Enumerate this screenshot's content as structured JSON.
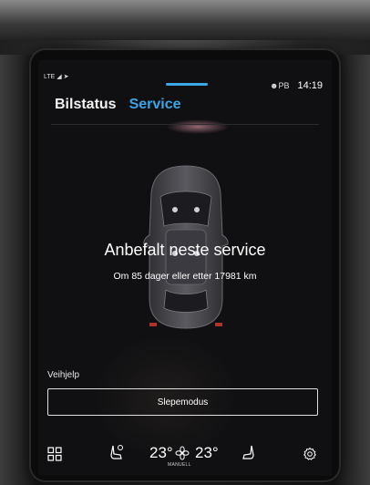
{
  "status_bar": {
    "network": "LTE",
    "system_indicator": "PB",
    "time": "14:19"
  },
  "tabs": [
    {
      "label": "Bilstatus",
      "active": false
    },
    {
      "label": "Service",
      "active": true
    }
  ],
  "service": {
    "title": "Anbefalt neste service",
    "subtitle": "Om 85 dager eller etter 17981 km"
  },
  "roadside": {
    "label": "Veihjelp",
    "tow_mode_button": "Slepemodus"
  },
  "climate": {
    "temp_left": "23°",
    "temp_right": "23°",
    "fan_mode": "MANUELL"
  },
  "colors": {
    "accent": "#3aa6e6",
    "background": "#101012",
    "text": "#ffffff"
  },
  "icons": {
    "apps": "apps-grid-icon",
    "seat_heat": "seat-heating-icon",
    "fan": "fan-icon",
    "settings": "settings-gear-icon"
  }
}
